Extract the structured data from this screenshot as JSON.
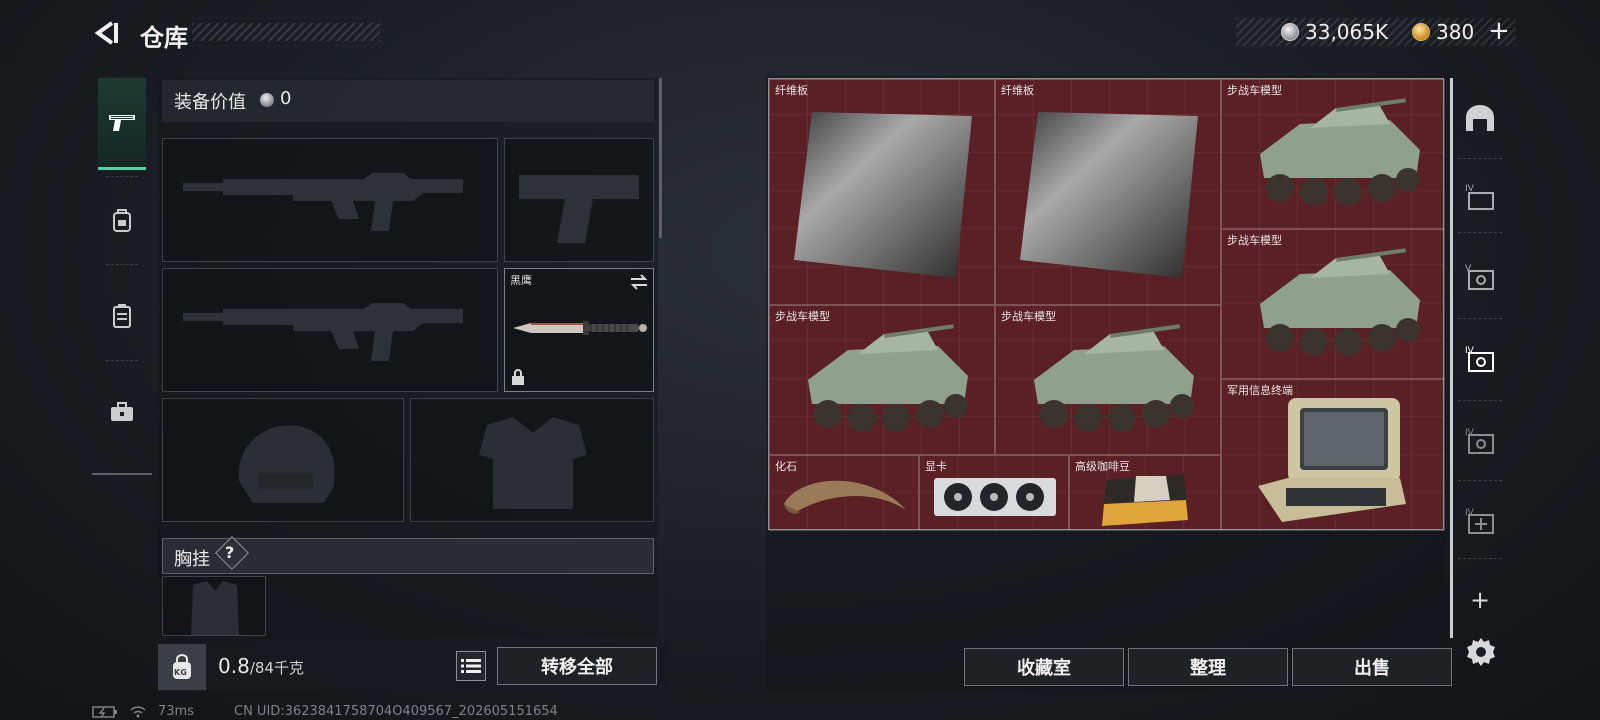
{
  "header": {
    "title": "仓库",
    "currency": {
      "silver": "33,065K",
      "gold": "380"
    },
    "plus_label": "+"
  },
  "equipment": {
    "value_label": "装备价值",
    "value": "0",
    "melee_slot": {
      "name": "黑鹰"
    },
    "chest_rig_label": "胸挂",
    "chest_rig_help": "?"
  },
  "weight": {
    "current": "0.8",
    "max": "/84千克",
    "icon_label": "KG"
  },
  "buttons": {
    "transfer_all": "转移全部",
    "collection": "收藏室",
    "sort": "整理",
    "sell": "出售",
    "add": "+"
  },
  "storage_items": [
    {
      "name": "纤维板",
      "icon": "fiberboard-icon"
    },
    {
      "name": "纤维板",
      "icon": "fiberboard-icon"
    },
    {
      "name": "步战车模型",
      "icon": "ifv-model-icon"
    },
    {
      "name": "步战车模型",
      "icon": "ifv-model-icon"
    },
    {
      "name": "步战车模型",
      "icon": "ifv-model-icon"
    },
    {
      "name": "步战车模型",
      "icon": "ifv-model-icon"
    },
    {
      "name": "军用信息终端",
      "icon": "military-terminal-icon"
    },
    {
      "name": "化石",
      "icon": "fossil-claw-icon"
    },
    {
      "name": "显卡",
      "icon": "graphics-card-icon"
    },
    {
      "name": "高级咖啡豆",
      "icon": "coffee-beans-icon"
    }
  ],
  "status": {
    "ping": "73ms",
    "uid": "CN UID:3623841758704O409567_202605151654"
  },
  "colors": {
    "storage_bg": "#5a2026",
    "active_tab": "#4fd3a0",
    "panel_bg": "#14181d"
  }
}
